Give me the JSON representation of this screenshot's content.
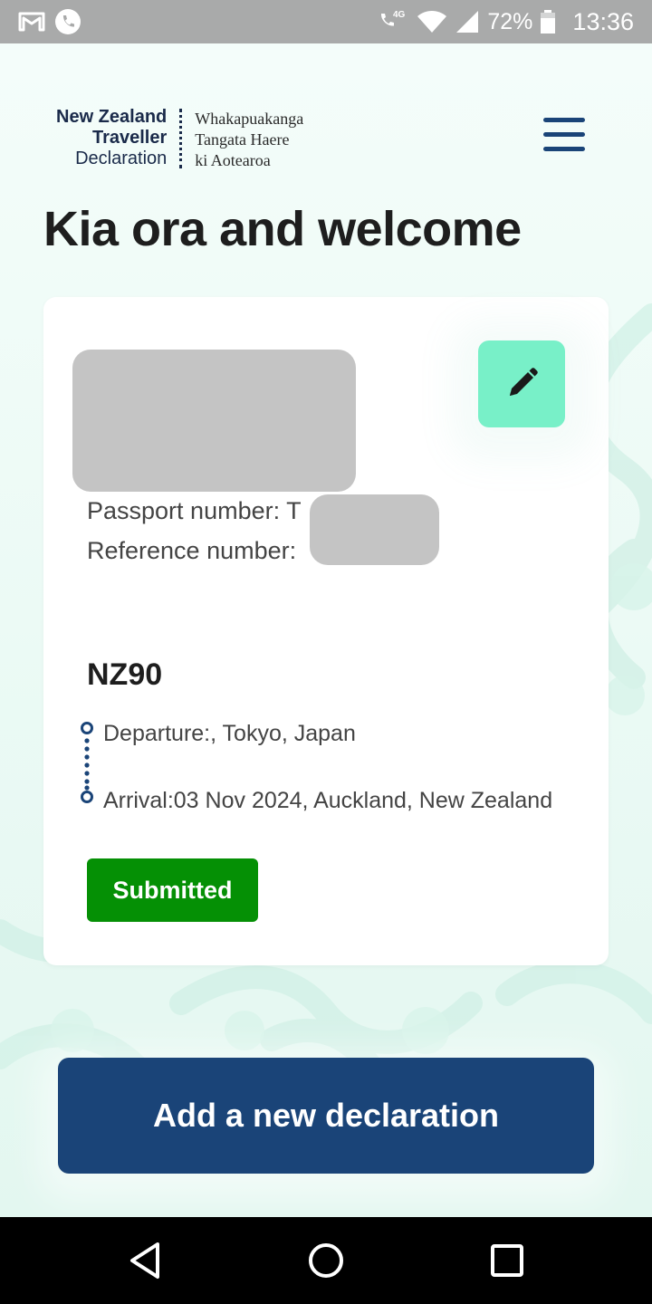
{
  "status_bar": {
    "network": "4G",
    "battery": "72%",
    "time": "13:36"
  },
  "header": {
    "logo_en": [
      "New Zealand",
      "Traveller",
      "Declaration"
    ],
    "logo_mi": [
      "Whakapuakanga",
      "Tangata Haere",
      "ki Aotearoa"
    ],
    "menu_icon": "hamburger-icon"
  },
  "page": {
    "title": "Kia ora and welcome"
  },
  "card": {
    "passport_label": "Passport number: T",
    "reference_label": "Reference number:",
    "flight": "NZ90",
    "departure": "Departure:, Tokyo, Japan",
    "arrival": "Arrival:03 Nov 2024, Auckland, New Zealand",
    "status": "Submitted",
    "edit_icon": "pencil-icon"
  },
  "cta": {
    "label": "Add a new declaration"
  },
  "colors": {
    "brand_navy": "#1a4478",
    "accent_mint": "#78f0c8",
    "status_green": "#059005",
    "background": "#eefbf7"
  },
  "nav": {
    "back_icon": "back-icon",
    "home_icon": "home-icon",
    "recents_icon": "recents-icon"
  }
}
